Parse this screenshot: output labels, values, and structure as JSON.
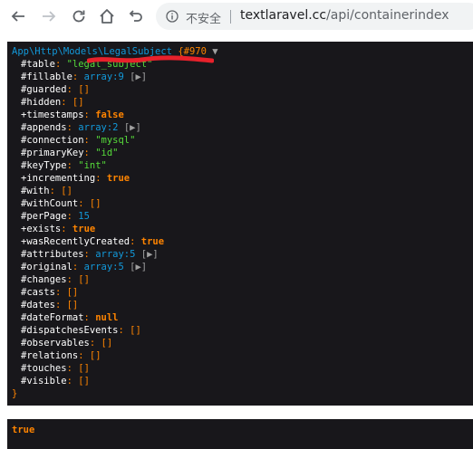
{
  "browser": {
    "security_label": "不安全",
    "url_host": "textlaravel.cc",
    "url_path": "/api/containerindex"
  },
  "dump": {
    "class_path": "App\\Http\\Models\\LegalSubject",
    "ref": "{#970",
    "toggle": "▼",
    "close_brace": "}",
    "props": [
      {
        "mod": "#",
        "name": "table",
        "sep": ": ",
        "value": "\"legal_subject\"",
        "kind": "str"
      },
      {
        "mod": "#",
        "name": "fillable",
        "sep": ": ",
        "value": "array:9",
        "kind": "arr",
        "expander": " [▶]"
      },
      {
        "mod": "#",
        "name": "guarded",
        "sep": ": ",
        "value": "[]",
        "kind": "punct"
      },
      {
        "mod": "#",
        "name": "hidden",
        "sep": ": ",
        "value": "[]",
        "kind": "punct"
      },
      {
        "mod": "+",
        "name": "timestamps",
        "sep": ": ",
        "value": "false",
        "kind": "const"
      },
      {
        "mod": "#",
        "name": "appends",
        "sep": ": ",
        "value": "array:2",
        "kind": "arr",
        "expander": " [▶]"
      },
      {
        "mod": "#",
        "name": "connection",
        "sep": ": ",
        "value": "\"mysql\"",
        "kind": "str"
      },
      {
        "mod": "#",
        "name": "primaryKey",
        "sep": ": ",
        "value": "\"id\"",
        "kind": "str"
      },
      {
        "mod": "#",
        "name": "keyType",
        "sep": ": ",
        "value": "\"int\"",
        "kind": "str"
      },
      {
        "mod": "+",
        "name": "incrementing",
        "sep": ": ",
        "value": "true",
        "kind": "const"
      },
      {
        "mod": "#",
        "name": "with",
        "sep": ": ",
        "value": "[]",
        "kind": "punct"
      },
      {
        "mod": "#",
        "name": "withCount",
        "sep": ": ",
        "value": "[]",
        "kind": "punct"
      },
      {
        "mod": "#",
        "name": "perPage",
        "sep": ": ",
        "value": "15",
        "kind": "num"
      },
      {
        "mod": "+",
        "name": "exists",
        "sep": ": ",
        "value": "true",
        "kind": "const"
      },
      {
        "mod": "+",
        "name": "wasRecentlyCreated",
        "sep": ": ",
        "value": "true",
        "kind": "const"
      },
      {
        "mod": "#",
        "name": "attributes",
        "sep": ": ",
        "value": "array:5",
        "kind": "arr",
        "expander": " [▶]"
      },
      {
        "mod": "#",
        "name": "original",
        "sep": ": ",
        "value": "array:5",
        "kind": "arr",
        "expander": " [▶]"
      },
      {
        "mod": "#",
        "name": "changes",
        "sep": ": ",
        "value": "[]",
        "kind": "punct"
      },
      {
        "mod": "#",
        "name": "casts",
        "sep": ": ",
        "value": "[]",
        "kind": "punct"
      },
      {
        "mod": "#",
        "name": "dates",
        "sep": ": ",
        "value": "[]",
        "kind": "punct"
      },
      {
        "mod": "#",
        "name": "dateFormat",
        "sep": ": ",
        "value": "null",
        "kind": "const"
      },
      {
        "mod": "#",
        "name": "dispatchesEvents",
        "sep": ": ",
        "value": "[]",
        "kind": "punct"
      },
      {
        "mod": "#",
        "name": "observables",
        "sep": ": ",
        "value": "[]",
        "kind": "punct"
      },
      {
        "mod": "#",
        "name": "relations",
        "sep": ": ",
        "value": "[]",
        "kind": "punct"
      },
      {
        "mod": "#",
        "name": "touches",
        "sep": ": ",
        "value": "[]",
        "kind": "punct"
      },
      {
        "mod": "#",
        "name": "visible",
        "sep": ": ",
        "value": "[]",
        "kind": "punct"
      }
    ]
  },
  "dump2": {
    "value": "true"
  },
  "colors": {
    "dump_bg": "#18171b",
    "redaction": "#e8212b"
  }
}
